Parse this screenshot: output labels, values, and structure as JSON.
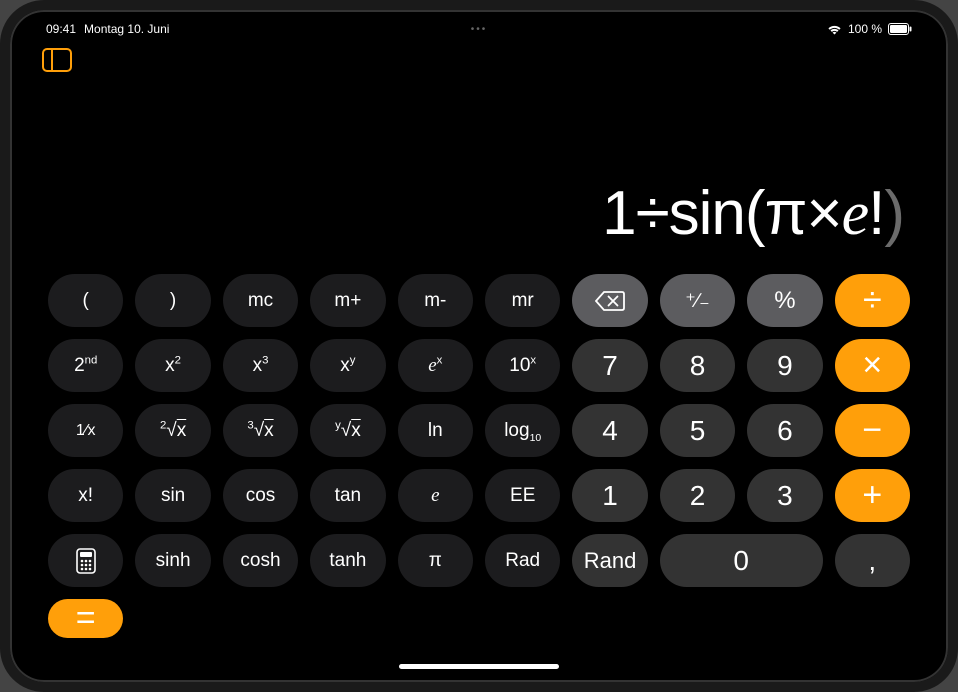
{
  "status": {
    "time": "09:41",
    "date": "Montag 10. Juni",
    "battery_text": "100 %"
  },
  "display": {
    "tokens": [
      {
        "t": "1",
        "cls": ""
      },
      {
        "t": "÷",
        "cls": ""
      },
      {
        "t": "sin",
        "cls": ""
      },
      {
        "t": "(",
        "cls": "open"
      },
      {
        "t": "π",
        "cls": ""
      },
      {
        "t": "×",
        "cls": ""
      },
      {
        "t": "e",
        "cls": "it"
      },
      {
        "t": "!",
        "cls": ""
      },
      {
        "t": ")",
        "cls": "close"
      }
    ]
  },
  "keys": {
    "r0": {
      "lparen": "(",
      "rparen": ")",
      "mc": "mc",
      "mplus": "m+",
      "mminus": "m-",
      "mr": "mr",
      "plusminus": "⁺∕₋",
      "percent": "%",
      "divide": "÷"
    },
    "r1": {
      "second_base": "2",
      "second_sup": "nd",
      "sq_base": "x",
      "sq_sup": "2",
      "cube_base": "x",
      "cube_sup": "3",
      "xy_base": "x",
      "xy_sup": "y",
      "ex_base": "e",
      "ex_sup": "x",
      "tenx_base": "10",
      "tenx_sup": "x",
      "7": "7",
      "8": "8",
      "9": "9",
      "mult": "×"
    },
    "r2": {
      "recip_top": "1",
      "recip_bot": "x",
      "sqrt_deg": "2",
      "sqrt_rad": "x",
      "cbrt_deg": "3",
      "cbrt_rad": "x",
      "yrt_deg": "y",
      "yrt_rad": "x",
      "ln": "ln",
      "log_base": "log",
      "log_sub": "10",
      "4": "4",
      "5": "5",
      "6": "6",
      "minus": "−"
    },
    "r3": {
      "fact": "x!",
      "sin": "sin",
      "cos": "cos",
      "tan": "tan",
      "e": "e",
      "EE": "EE",
      "1": "1",
      "2": "2",
      "3": "3",
      "plus": "+"
    },
    "r4": {
      "sinh": "sinh",
      "cosh": "cosh",
      "tanh": "tanh",
      "pi": "π",
      "rad": "Rad",
      "rand": "Rand",
      "0": "0",
      "comma": ",",
      "equals": "="
    }
  }
}
